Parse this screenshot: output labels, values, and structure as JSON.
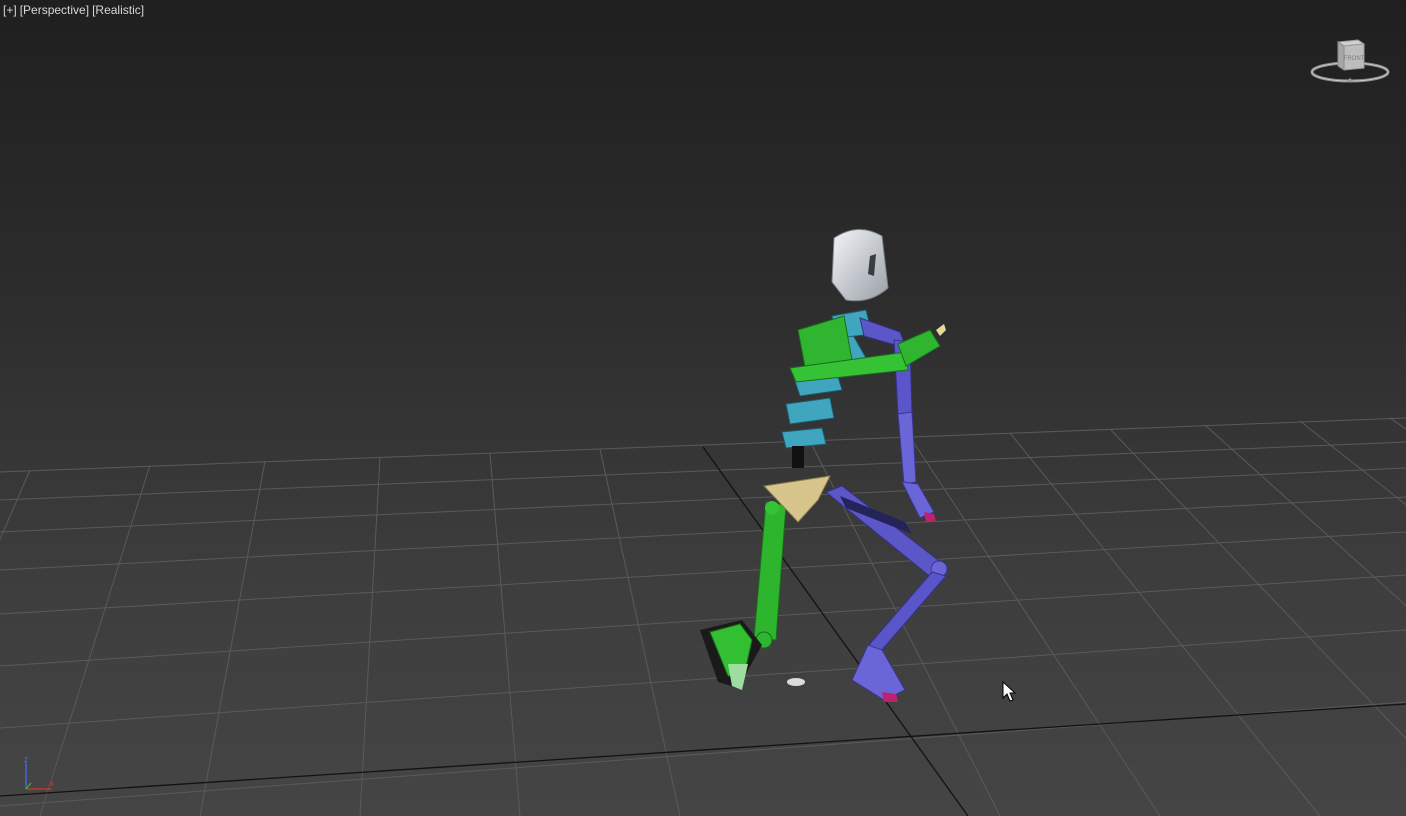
{
  "viewport": {
    "menu_plus": "[+]",
    "menu_view": "[Perspective]",
    "menu_shading": "[Realistic]"
  },
  "viewcube": {
    "face_label": "FRONT",
    "icon": "viewcube-icon"
  },
  "axis_tripod": {
    "x_label": "x",
    "z_label": "z",
    "icon": "axis-tripod-icon"
  },
  "colors": {
    "background_top": "#1f1f1f",
    "background_bottom": "#454545",
    "grid_line": "#595959",
    "grid_axis": "#111111",
    "biped_left_limbs": "#2fb52f",
    "biped_right_limbs": "#5a55c8",
    "biped_spine": "#40a6bf",
    "biped_pelvis": "#d8c58c",
    "biped_head": "#d7dbe0"
  }
}
